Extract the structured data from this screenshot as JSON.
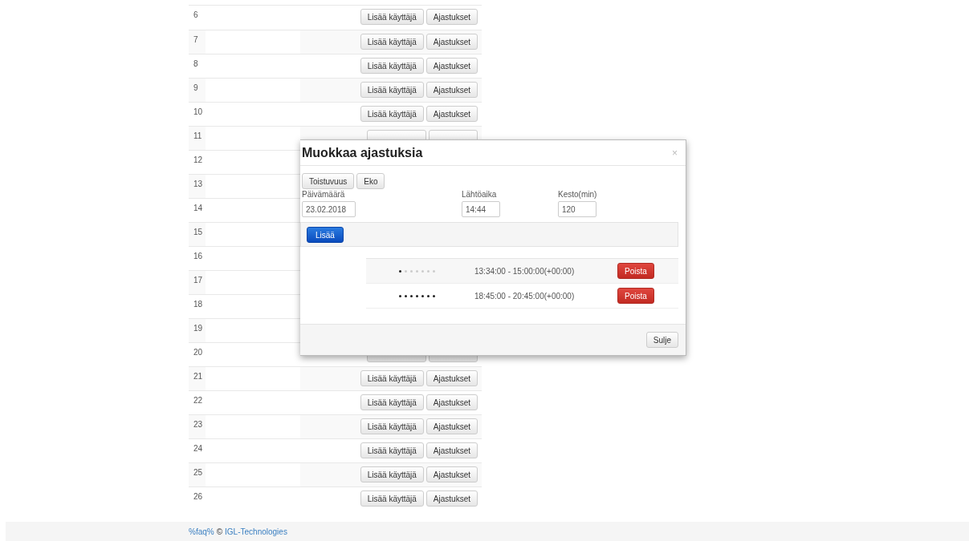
{
  "table": {
    "rows": [
      {
        "number": "6",
        "actions": [
          "Lisää käyttäjä",
          "Ajastukset"
        ]
      },
      {
        "number": "7",
        "actions": [
          "Lisää käyttäjä",
          "Ajastukset"
        ]
      },
      {
        "number": "8",
        "actions": [
          "Lisää käyttäjä",
          "Ajastukset"
        ]
      },
      {
        "number": "9",
        "actions": [
          "Lisää käyttäjä",
          "Ajastukset"
        ]
      },
      {
        "number": "10",
        "actions": [
          "Lisää käyttäjä",
          "Ajastukset"
        ]
      },
      {
        "number": "11",
        "buttons_covered": true
      },
      {
        "number": "12"
      },
      {
        "number": "13"
      },
      {
        "number": "14"
      },
      {
        "number": "15"
      },
      {
        "number": "16"
      },
      {
        "number": "17"
      },
      {
        "number": "18"
      },
      {
        "number": "19"
      },
      {
        "number": "20",
        "buttons_covered": true
      },
      {
        "number": "21",
        "actions": [
          "Lisää käyttäjä",
          "Ajastukset"
        ]
      },
      {
        "number": "22",
        "actions": [
          "Lisää käyttäjä",
          "Ajastukset"
        ]
      },
      {
        "number": "23",
        "actions": [
          "Lisää käyttäjä",
          "Ajastukset"
        ]
      },
      {
        "number": "24",
        "actions": [
          "Lisää käyttäjä",
          "Ajastukset"
        ]
      },
      {
        "number": "25",
        "actions": [
          "Lisää käyttäjä",
          "Ajastukset"
        ]
      },
      {
        "number": "26",
        "actions": [
          "Lisää käyttäjä",
          "Ajastukset"
        ]
      }
    ]
  },
  "modal": {
    "title": "Muokkaa ajastuksia",
    "close": "×",
    "mode_buttons": [
      "Toistuvuus",
      "Eko"
    ],
    "fields": [
      {
        "label": "Päivämäärä",
        "value": "23.02.2018"
      },
      {
        "label": "Lähtöaika",
        "value": "14:44"
      },
      {
        "label": "Kesto(min)",
        "value": "120"
      }
    ],
    "add_button": "Lisää",
    "schedules": [
      {
        "days": [
          true,
          false,
          false,
          false,
          false,
          false,
          false
        ],
        "time": "13:34:00 - 15:00:00(+00:00)",
        "delete_button": "Poista"
      },
      {
        "days": [
          true,
          true,
          true,
          true,
          true,
          true,
          true
        ],
        "time": "18:45:00 - 20:45:00(+00:00)",
        "delete_button": "Poista"
      }
    ],
    "close_button": "Sulje"
  },
  "footer": {
    "faq_link": "%faq%",
    "copyright": "©",
    "company_link": "IGL-Technologies"
  }
}
